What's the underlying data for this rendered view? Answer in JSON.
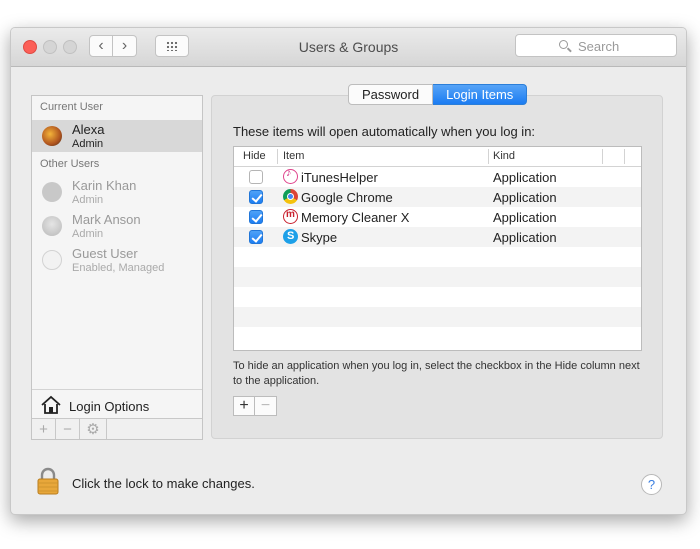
{
  "window": {
    "title": "Users & Groups"
  },
  "toolbar": {
    "back_icon": "chevron-left-icon",
    "forward_icon": "chevron-right-icon",
    "grid_icon": "grid-icon"
  },
  "search": {
    "placeholder": "Search"
  },
  "sidebar": {
    "current_user_heading": "Current User",
    "other_users_heading": "Other Users",
    "users": [
      {
        "name": "Alexa",
        "role": "Admin",
        "selected": true
      },
      {
        "name": "Karin Khan",
        "role": "Admin"
      },
      {
        "name": "Mark Anson",
        "role": "Admin"
      },
      {
        "name": "Guest User",
        "role": "Enabled, Managed"
      }
    ],
    "login_options": "Login Options",
    "add_label": "+",
    "remove_label": "−",
    "gear_label": "⚙"
  },
  "tabs": [
    {
      "label": "Password",
      "active": false
    },
    {
      "label": "Login Items",
      "active": true
    }
  ],
  "login_items": {
    "intro": "These items will open automatically when you log in:",
    "columns": {
      "hide": "Hide",
      "item": "Item",
      "kind": "Kind"
    },
    "rows": [
      {
        "hide": false,
        "icon": "itunes-icon",
        "item": "iTunesHelper",
        "kind": "Application"
      },
      {
        "hide": true,
        "icon": "chrome-icon",
        "item": "Google Chrome",
        "kind": "Application"
      },
      {
        "hide": true,
        "icon": "memory-cleaner-icon",
        "item": "Memory Cleaner X",
        "kind": "Application"
      },
      {
        "hide": true,
        "icon": "skype-icon",
        "item": "Skype",
        "kind": "Application"
      }
    ],
    "hint": "To hide an application when you log in, select the checkbox in the Hide column next to the application.",
    "add_label": "+",
    "remove_label": "−"
  },
  "footer": {
    "lock_text": "Click the lock to make changes.",
    "help_label": "?"
  },
  "colors": {
    "accent": "#1d7ef2",
    "close": "#fc5f57"
  }
}
